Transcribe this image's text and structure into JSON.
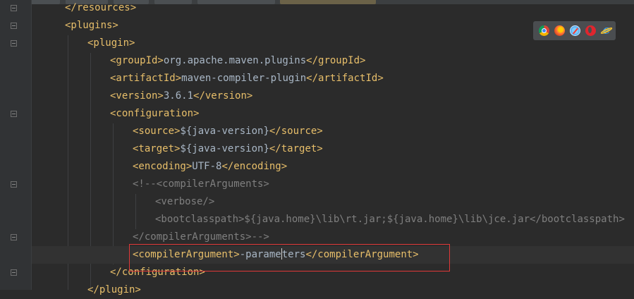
{
  "editor": {
    "language": "xml",
    "lines": [
      {
        "parts": [
          {
            "kind": "tag",
            "text": "</resources>"
          }
        ]
      },
      {
        "parts": [
          {
            "kind": "tag",
            "text": "<plugins>"
          }
        ]
      },
      {
        "parts": [
          {
            "kind": "tag",
            "text": "<plugin>"
          }
        ]
      },
      {
        "parts": [
          {
            "kind": "tag",
            "text": "<groupId>"
          },
          {
            "kind": "txt",
            "text": "org.apache.maven.plugins"
          },
          {
            "kind": "tag",
            "text": "</groupId>"
          }
        ]
      },
      {
        "parts": [
          {
            "kind": "tag",
            "text": "<artifactId>"
          },
          {
            "kind": "txt",
            "text": "maven-compiler-plugin"
          },
          {
            "kind": "tag",
            "text": "</artifactId>"
          }
        ]
      },
      {
        "parts": [
          {
            "kind": "tag",
            "text": "<version>"
          },
          {
            "kind": "txt",
            "text": "3.6.1"
          },
          {
            "kind": "tag",
            "text": "</version>"
          }
        ]
      },
      {
        "parts": [
          {
            "kind": "tag",
            "text": "<configuration>"
          }
        ]
      },
      {
        "parts": [
          {
            "kind": "tag",
            "text": "<source>"
          },
          {
            "kind": "txt",
            "text": "${java-version}"
          },
          {
            "kind": "tag",
            "text": "</source>"
          }
        ]
      },
      {
        "parts": [
          {
            "kind": "tag",
            "text": "<target>"
          },
          {
            "kind": "txt",
            "text": "${java-version}"
          },
          {
            "kind": "tag",
            "text": "</target>"
          }
        ]
      },
      {
        "parts": [
          {
            "kind": "tag",
            "text": "<encoding>"
          },
          {
            "kind": "txt",
            "text": "UTF-8"
          },
          {
            "kind": "tag",
            "text": "</encoding>"
          }
        ]
      },
      {
        "parts": [
          {
            "kind": "com",
            "text": "<!--<compilerArguments>"
          }
        ]
      },
      {
        "parts": [
          {
            "kind": "com",
            "text": "<verbose/>"
          }
        ]
      },
      {
        "parts": [
          {
            "kind": "com",
            "text": "<bootclasspath>${java.home}\\lib\\rt.jar;${java.home}\\lib\\jce.jar</bootclasspath>"
          }
        ]
      },
      {
        "parts": [
          {
            "kind": "com",
            "text": "</compilerArguments>-->"
          }
        ]
      },
      {
        "parts": [
          {
            "kind": "tag",
            "text": "<compilerArgument>"
          },
          {
            "kind": "txt",
            "text": "-parame"
          },
          {
            "kind": "caret",
            "text": ""
          },
          {
            "kind": "txt",
            "text": "ters"
          },
          {
            "kind": "tag",
            "text": "</compilerArgument>"
          }
        ]
      },
      {
        "parts": [
          {
            "kind": "tag",
            "text": "</configuration>"
          }
        ]
      },
      {
        "parts": [
          {
            "kind": "tag",
            "text": "</plugin>"
          }
        ]
      }
    ]
  },
  "browser_icons": [
    "chrome-icon",
    "firefox-icon",
    "safari-icon",
    "opera-icon",
    "internet-explorer-icon"
  ],
  "colors": {
    "background": "#2b2b2b",
    "tag": "#e8bf6a",
    "text": "#a9b7c6",
    "comment": "#7f7f7f",
    "highlight_border": "#e03838"
  }
}
